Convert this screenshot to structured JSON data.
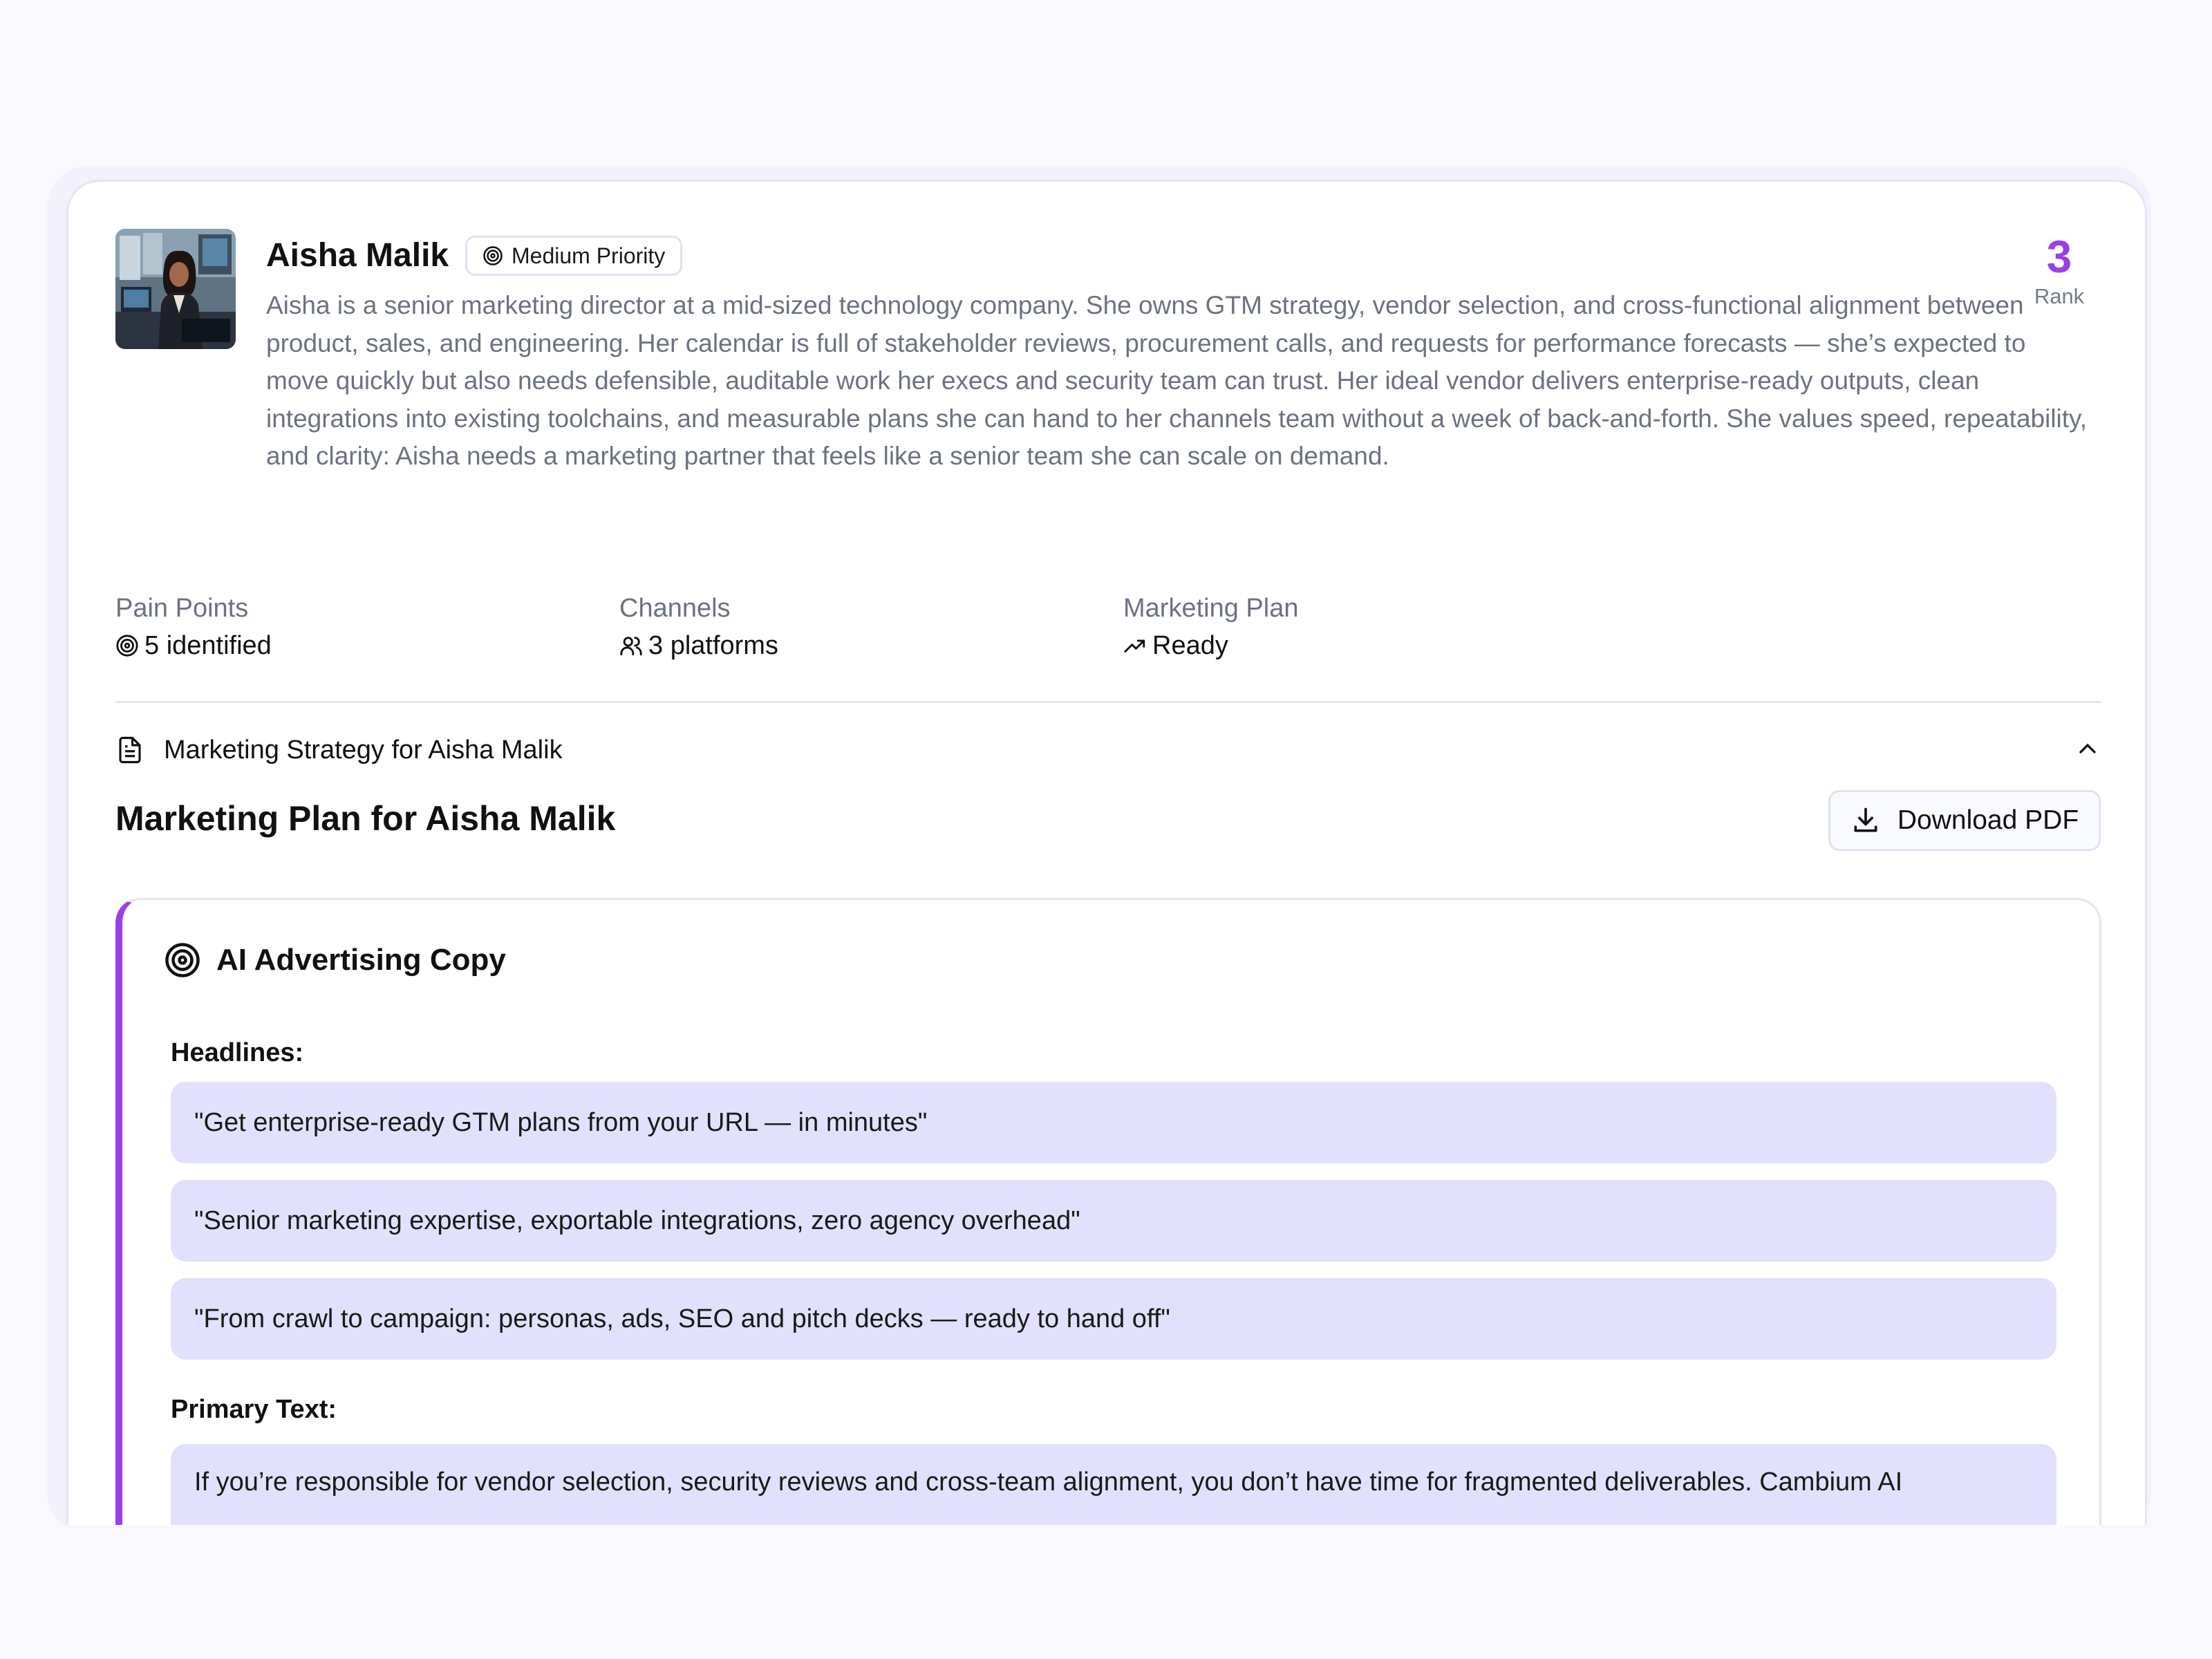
{
  "profile": {
    "name": "Aisha Malik",
    "priority_label": "Medium Priority",
    "rank_value": "3",
    "rank_label": "Rank",
    "description": "Aisha is a senior marketing director at a mid-sized technology company. She owns GTM strategy, vendor selection, and cross-functional alignment between product, sales, and engineering. Her calendar is full of stakeholder reviews, procurement calls, and requests for performance forecasts — she’s expected to move quickly but also needs defensible, auditable work her execs and security team can trust. Her ideal vendor delivers enterprise-ready outputs, clean integrations into existing toolchains, and measurable plans she can hand to her channels team without a week of back-and-forth. She values speed, repeatability, and clarity: Aisha needs a marketing partner that feels like a senior team she can scale on demand.",
    "accent_color": "#9b3fe8"
  },
  "stats": [
    {
      "label": "Pain Points",
      "value": "5 identified",
      "icon": "target-icon"
    },
    {
      "label": "Channels",
      "value": "3 platforms",
      "icon": "users-icon"
    },
    {
      "label": "Marketing Plan",
      "value": "Ready",
      "icon": "trending-up-icon"
    }
  ],
  "strategy": {
    "section_title": "Marketing Strategy for Aisha Malik",
    "plan_title": "Marketing Plan for Aisha Malik",
    "download_label": "Download PDF"
  },
  "ad_copy": {
    "title": "AI Advertising Copy",
    "headlines_label": "Headlines:",
    "headlines": [
      "\"Get enterprise-ready GTM plans from your URL — in minutes\"",
      "\"Senior marketing expertise, exportable integrations, zero agency overhead\"",
      "\"From crawl to campaign: personas, ads, SEO and pitch decks — ready to hand off\""
    ],
    "primary_text_label": "Primary Text:",
    "primary_text": "If you’re responsible for vendor selection, security reviews and cross-team alignment, you don’t have time for fragmented deliverables. Cambium AI"
  }
}
